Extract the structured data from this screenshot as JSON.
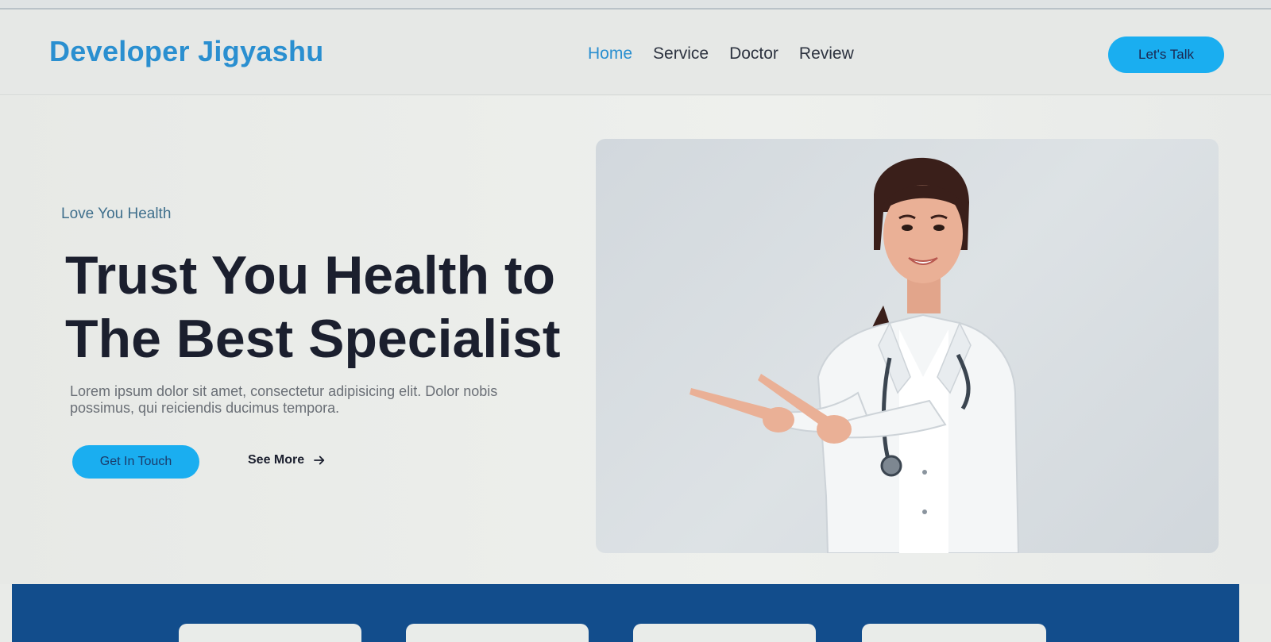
{
  "brand": {
    "logo_text": "Developer Jigyashu",
    "accent_color": "#2a8fd0"
  },
  "nav": {
    "items": [
      {
        "label": "Home",
        "active": true
      },
      {
        "label": "Service",
        "active": false
      },
      {
        "label": "Doctor",
        "active": false
      },
      {
        "label": "Review",
        "active": false
      }
    ],
    "cta_label": "Let's Talk"
  },
  "hero": {
    "eyebrow": "Love You Health",
    "headline_line1": "Trust You Health to",
    "headline_line2": "The Best Specialist",
    "description": "Lorem ipsum dolor sit amet, consectetur adipisicing elit. Dolor nobis possimus, qui reiciendis ducimus tempora.",
    "primary_button": "Get In Touch",
    "secondary_link": "See More",
    "secondary_icon": "arrow-right-icon",
    "image": "doctor-pointing-photo"
  },
  "band": {
    "color": "#124d8c",
    "card_count": 4
  },
  "colors": {
    "button": "#1aaef0",
    "heading": "#1b1f2e"
  }
}
